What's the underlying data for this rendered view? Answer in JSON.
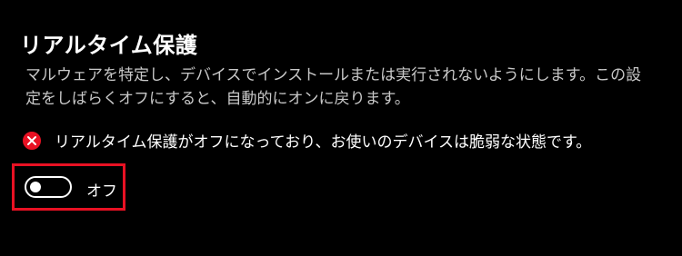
{
  "section": {
    "title": "リアルタイム保護",
    "description": "マルウェアを特定し、デバイスでインストールまたは実行されないようにします。この設定をしばらくオフにすると、自動的にオンに戻ります。"
  },
  "warning": {
    "icon": "error-circle-icon",
    "icon_color": "#e81123",
    "text": "リアルタイム保護がオフになっており、お使いのデバイスは脆弱な状態です。"
  },
  "toggle": {
    "state": "off",
    "label": "オフ"
  },
  "colors": {
    "background": "#000000",
    "highlight_border": "#e81123",
    "text_primary": "#ffffff",
    "text_secondary": "#c8c8c8"
  }
}
